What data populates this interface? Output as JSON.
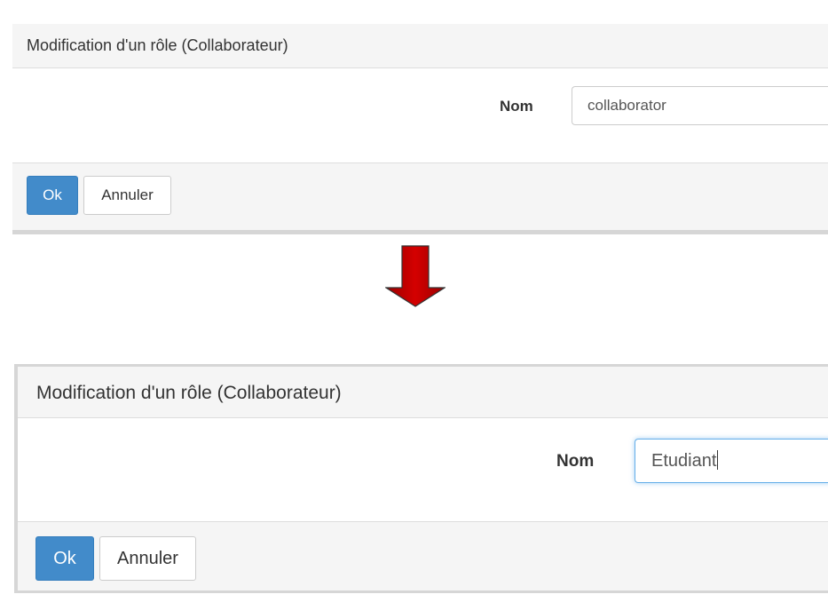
{
  "before": {
    "title": "Modification d'un rôle (Collaborateur)",
    "name_label": "Nom",
    "name_value": "collaborator",
    "ok_label": "Ok",
    "cancel_label": "Annuler"
  },
  "after": {
    "title": "Modification d'un rôle (Collaborateur)",
    "name_label": "Nom",
    "name_value": "Etudiant",
    "ok_label": "Ok",
    "cancel_label": "Annuler"
  },
  "arrow": {
    "icon": "down-arrow-icon",
    "color": "#cc0000"
  },
  "colors": {
    "primary": "#428bca",
    "focus": "#66afe9"
  }
}
